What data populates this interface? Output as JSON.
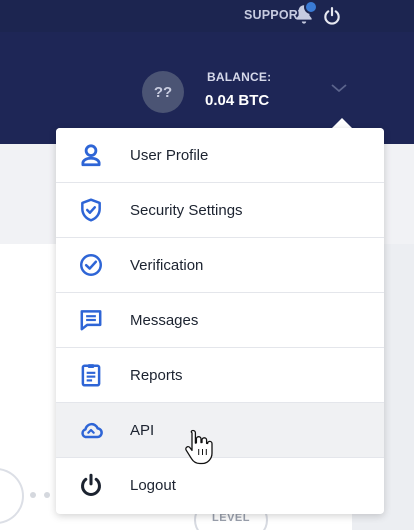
{
  "topbar": {
    "support_label": "SUPPORT",
    "icons": [
      "bell-icon",
      "power-icon"
    ]
  },
  "account": {
    "avatar_initials": "??",
    "balance_label": "BALANCE:",
    "balance_value": "0.04 BTC"
  },
  "background": {
    "level_label": "LEVEL"
  },
  "menu": {
    "items": [
      {
        "label": "User Profile",
        "icon": "user-icon"
      },
      {
        "label": "Security Settings",
        "icon": "shield-icon"
      },
      {
        "label": "Verification",
        "icon": "check-circle-icon"
      },
      {
        "label": "Messages",
        "icon": "message-icon"
      },
      {
        "label": "Reports",
        "icon": "clipboard-icon"
      },
      {
        "label": "API",
        "icon": "cloud-icon"
      },
      {
        "label": "Logout",
        "icon": "power-icon"
      }
    ],
    "hovered_item": "API"
  },
  "colors": {
    "header_bg": "#1e2656",
    "topbar_bg": "#1c2550",
    "accent": "#2e65d6",
    "text_dark": "#1c2330"
  }
}
